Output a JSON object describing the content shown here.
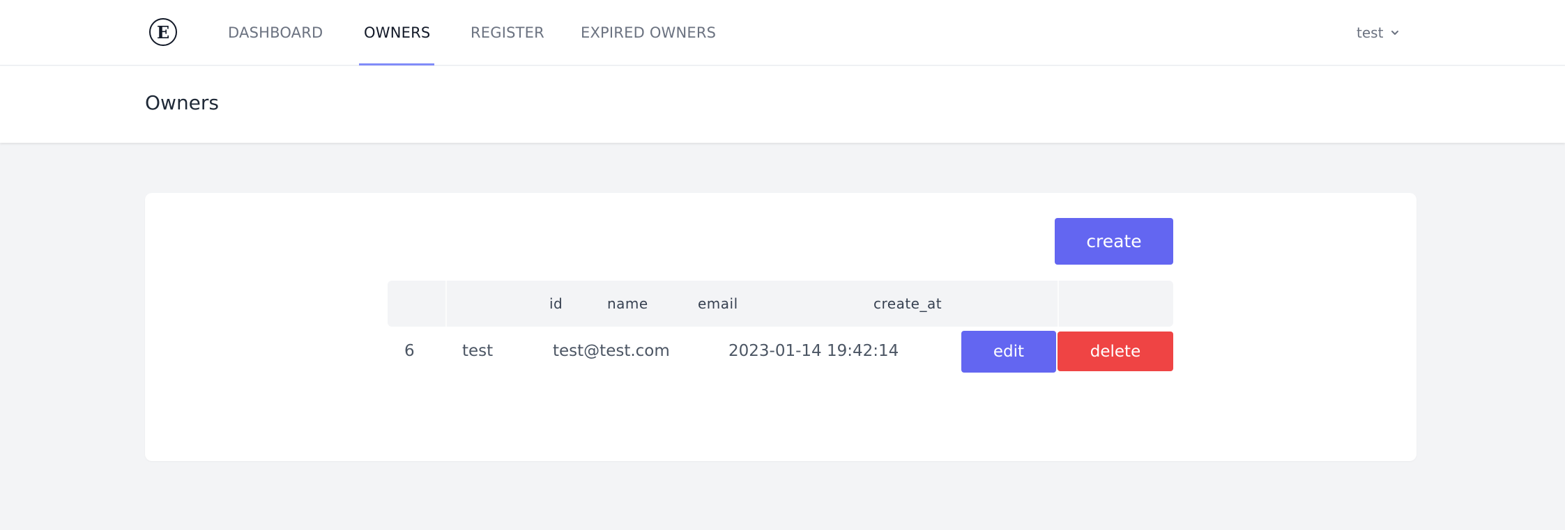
{
  "nav": {
    "logo_letter": "E",
    "links": [
      {
        "label": "DASHBOARD"
      },
      {
        "label": "OWNERS"
      },
      {
        "label": "REGISTER"
      },
      {
        "label": "EXPIRED OWNERS"
      }
    ],
    "active": "OWNERS",
    "user": {
      "name": "test",
      "icon": "chevron-down-icon"
    }
  },
  "header": {
    "title": "Owners"
  },
  "main": {
    "create_label": "create",
    "table": {
      "columns": [
        "id",
        "name",
        "email",
        "create_at"
      ],
      "rows": [
        {
          "id": "6",
          "name": "test",
          "email": "test@test.com",
          "create_at": "2023-01-14 19:42:14",
          "edit_label": "edit",
          "delete_label": "delete"
        }
      ]
    }
  },
  "colors": {
    "accent": "#6366f1",
    "danger": "#ef4444",
    "nav_underline": "#818cf8",
    "background": "#f3f4f6"
  }
}
